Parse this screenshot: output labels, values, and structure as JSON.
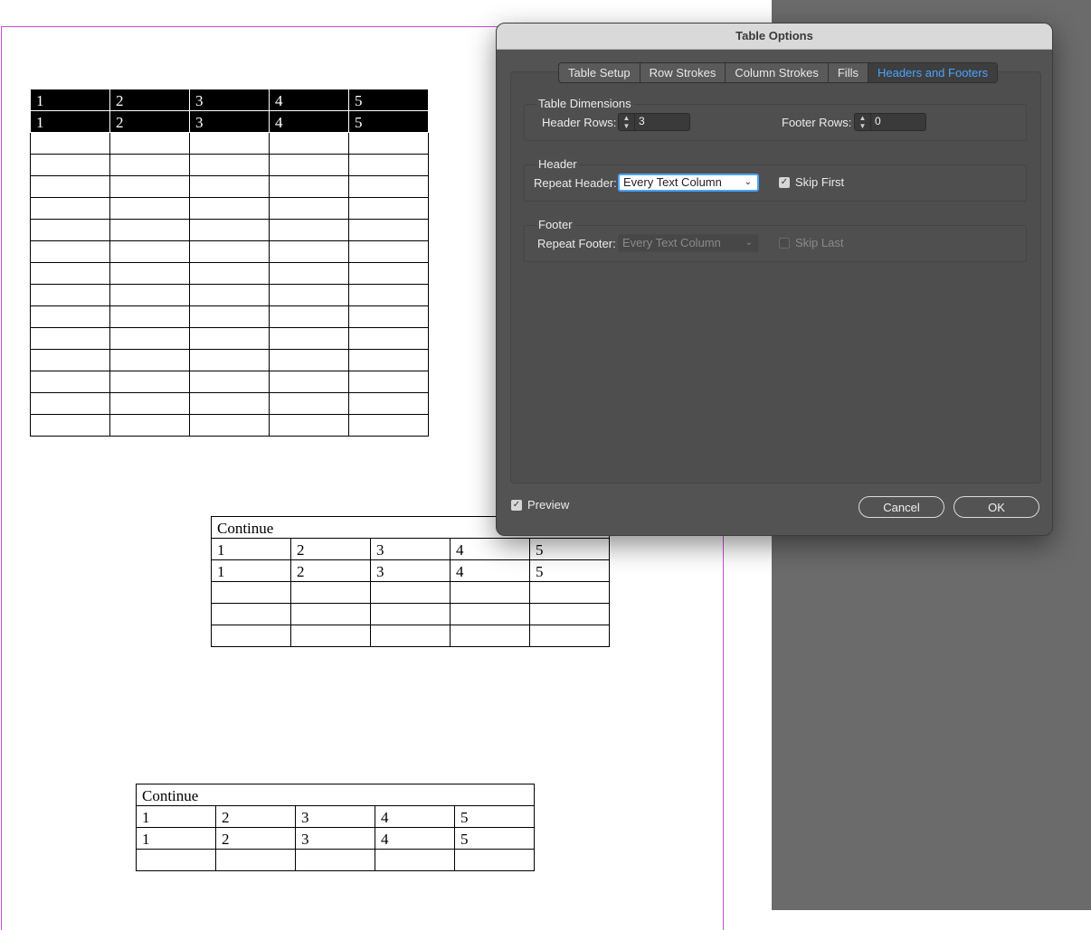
{
  "dialog": {
    "title": "Table Options",
    "tabs": [
      "Table Setup",
      "Row Strokes",
      "Column Strokes",
      "Fills",
      "Headers and Footers"
    ],
    "active_tab": "Headers and Footers",
    "table_dimensions": {
      "title": "Table Dimensions",
      "header_rows_label": "Header Rows:",
      "header_rows_value": "3",
      "footer_rows_label": "Footer Rows:",
      "footer_rows_value": "0"
    },
    "header": {
      "title": "Header",
      "repeat_label": "Repeat Header:",
      "repeat_value": "Every Text Column",
      "skip_first_label": "Skip First",
      "skip_first_checked": true
    },
    "footer": {
      "title": "Footer",
      "repeat_label": "Repeat Footer:",
      "repeat_value": "Every Text Column",
      "skip_last_label": "Skip Last",
      "skip_last_checked": false
    },
    "preview_label": "Preview",
    "preview_checked": true,
    "cancel_label": "Cancel",
    "ok_label": "OK"
  },
  "document": {
    "continue_label": "Continue",
    "header_cells": [
      "1",
      "2",
      "3",
      "4",
      "5"
    ],
    "table1_header_rows": 2,
    "table1_empty_rows": 14,
    "table2_empty_rows": 3,
    "table3_empty_rows": 1
  }
}
